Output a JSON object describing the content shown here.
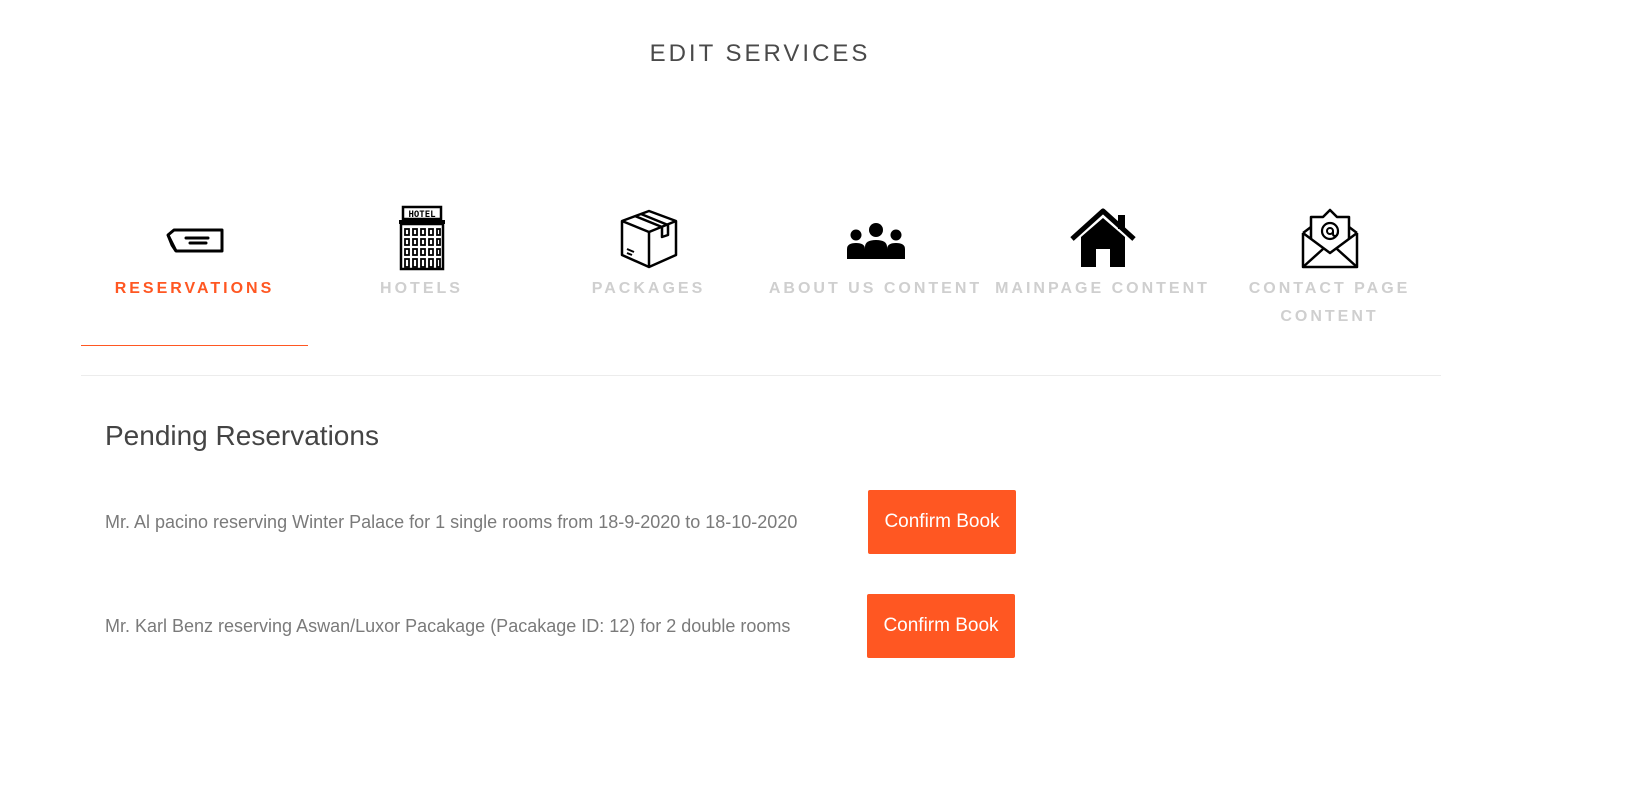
{
  "header": {
    "title": "EDIT SERVICES"
  },
  "tabs": [
    {
      "label": "RESERVATIONS",
      "icon": "reservation-ticket-icon",
      "active": true
    },
    {
      "label": "HOTELS",
      "icon": "hotel-building-icon",
      "active": false
    },
    {
      "label": "PACKAGES",
      "icon": "package-box-icon",
      "active": false
    },
    {
      "label": "ABOUT US CONTENT",
      "icon": "people-group-icon",
      "active": false
    },
    {
      "label": "MAINPAGE CONTENT",
      "icon": "house-icon",
      "active": false
    },
    {
      "label": "CONTACT PAGE CONTENT",
      "icon": "email-envelope-icon",
      "active": false
    }
  ],
  "reservations": {
    "title": "Pending Reservations",
    "items": [
      {
        "text": "Mr. Al pacino reserving Winter Palace for 1 single rooms from 18-9-2020 to 18-10-2020",
        "button_label": "Confirm Book"
      },
      {
        "text": "Mr. Karl Benz reserving Aswan/Luxor Pacakage (Pacakage ID: 12) for 2 double rooms",
        "button_label": "Confirm Book"
      }
    ]
  },
  "colors": {
    "accent": "#ff5722",
    "inactive_tab": "#cfcfcf",
    "body_text": "#7a7a7a",
    "heading_text": "#444444"
  }
}
